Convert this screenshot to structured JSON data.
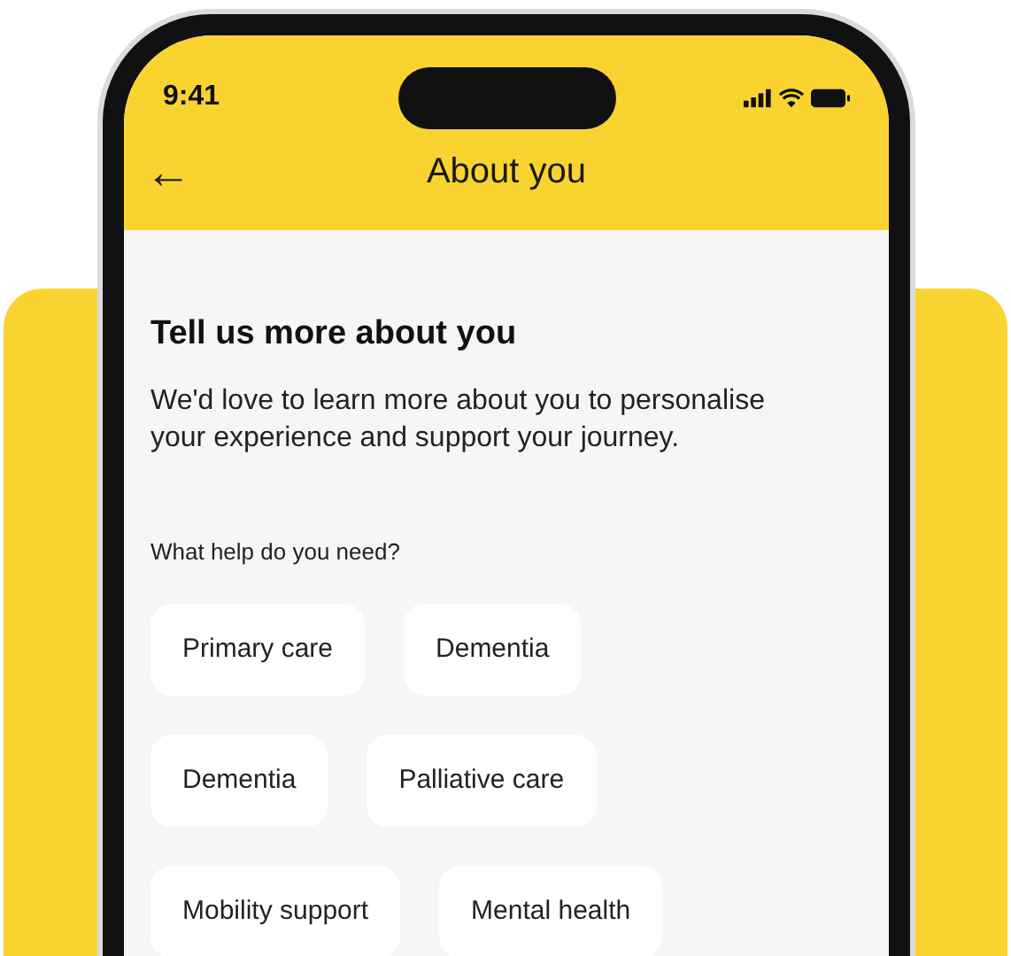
{
  "status_bar": {
    "time": "9:41"
  },
  "header": {
    "back": "←",
    "title": "About you"
  },
  "content": {
    "heading": "Tell us more about you",
    "description": "We'd love to learn more about you to personalise your experience and support your journey.",
    "question": "What help do you need?",
    "option_rows": [
      [
        "Primary care",
        "Dementia"
      ],
      [
        "Dementia",
        "Palliative care"
      ],
      [
        "Mobility support",
        "Mental health"
      ]
    ]
  }
}
